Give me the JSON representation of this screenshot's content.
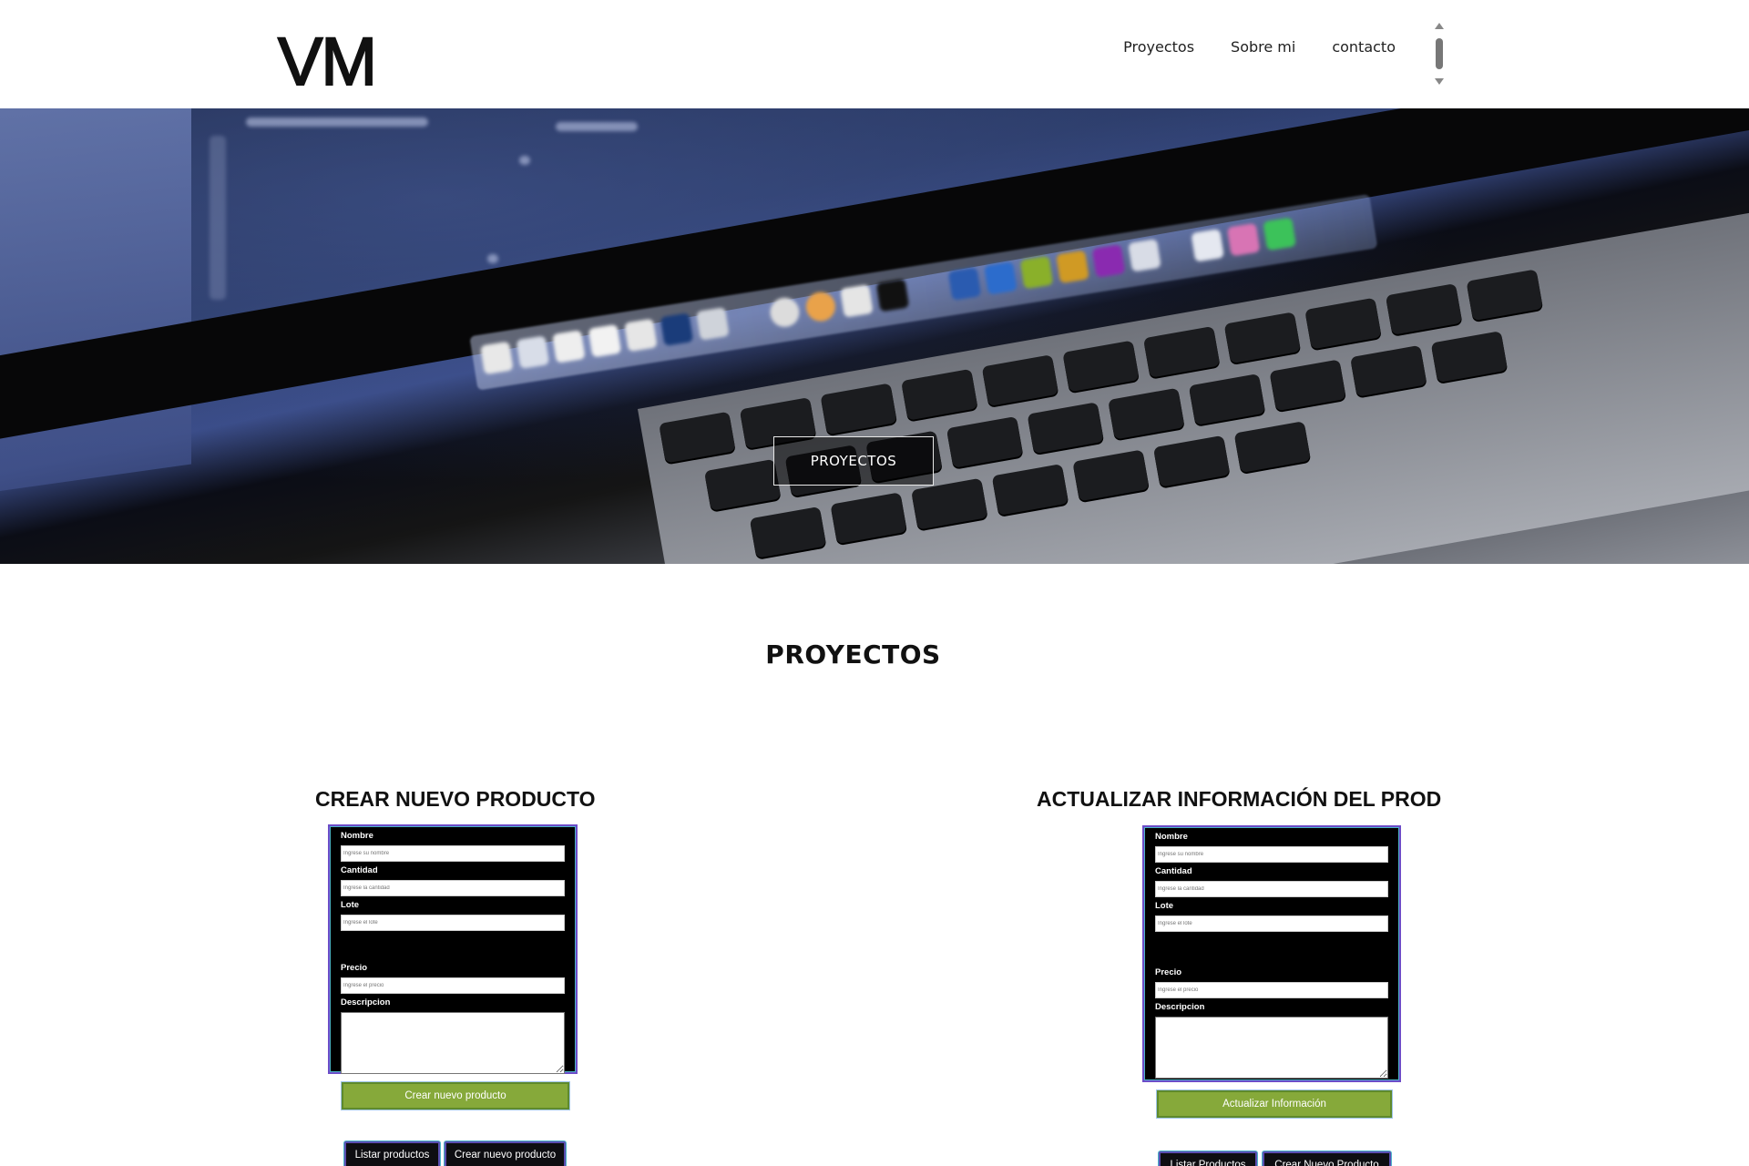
{
  "header": {
    "logo": "VM",
    "nav": [
      "Proyectos",
      "Sobre mi",
      "contacto"
    ]
  },
  "hero": {
    "button_label": "PROYECTOS"
  },
  "section": {
    "title": "PROYECTOS"
  },
  "cards": [
    {
      "title": "CREAR NUEVO PRODUCTO",
      "fields": [
        {
          "label": "Nombre",
          "placeholder": "Ingrese su nombre"
        },
        {
          "label": "Cantidad",
          "placeholder": "Ingrese la cantidad"
        },
        {
          "label": "Lote",
          "placeholder": "Ingrese el lote"
        },
        {
          "label": "Precio",
          "placeholder": "Ingrese el precio"
        }
      ],
      "description_label": "Descripcion",
      "submit_label": "Crear nuevo producto",
      "buttons": [
        "Listar productos",
        "Crear nuevo producto"
      ]
    },
    {
      "title": "ACTUALIZAR INFORMACIÓN DEL PROD",
      "fields": [
        {
          "label": "Nombre",
          "placeholder": "Ingrese su nombre"
        },
        {
          "label": "Cantidad",
          "placeholder": "Ingrese la cantidad"
        },
        {
          "label": "Lote",
          "placeholder": "Ingrese el lote"
        },
        {
          "label": "Precio",
          "placeholder": "Ingrese el precio"
        }
      ],
      "description_label": "Descripcion",
      "submit_label": "Actualizar Información",
      "buttons": [
        "Listar Productos",
        "Crear Nuevo Producto"
      ]
    }
  ],
  "colors": {
    "accent_green": "#86a93a",
    "form_border": "#6c4cc8",
    "form_bg": "#000000"
  }
}
